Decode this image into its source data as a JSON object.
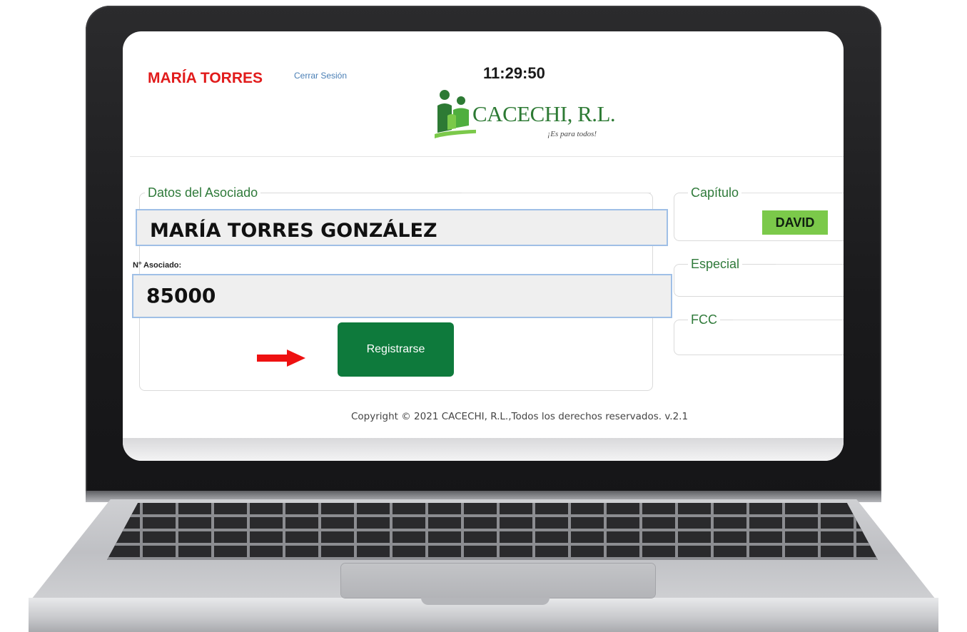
{
  "header": {
    "user_name": "MARÍA TORRES",
    "logout_label": "Cerrar Sesión",
    "clock": "11:29:50"
  },
  "logo": {
    "name": "CACECHI, R.L.",
    "slogan": "¡Es para todos!",
    "icon": "people-logo-icon"
  },
  "associate": {
    "legend": "Datos del Asociado",
    "full_name": "MARÍA TORRES GONZÁLEZ",
    "number_label": "N° Asociado:",
    "number": "85000",
    "register_label": "Registrarse",
    "arrow_icon": "right-arrow-icon"
  },
  "side_panels": {
    "capitulo_legend": "Capítulo",
    "capitulo_value": "DAVID",
    "especial_legend": "Especial",
    "fcc_legend": "FCC"
  },
  "footer": {
    "copyright": "Copyright © 2021 CACECHI, R.L.,Todos los derechos reservados. v.2.1"
  },
  "colors": {
    "brand_green": "#0e7a3c",
    "legend_green": "#2f7a3a",
    "user_red": "#e11b1b",
    "badge_green": "#7bc94a",
    "field_border": "#9fbfe6"
  }
}
